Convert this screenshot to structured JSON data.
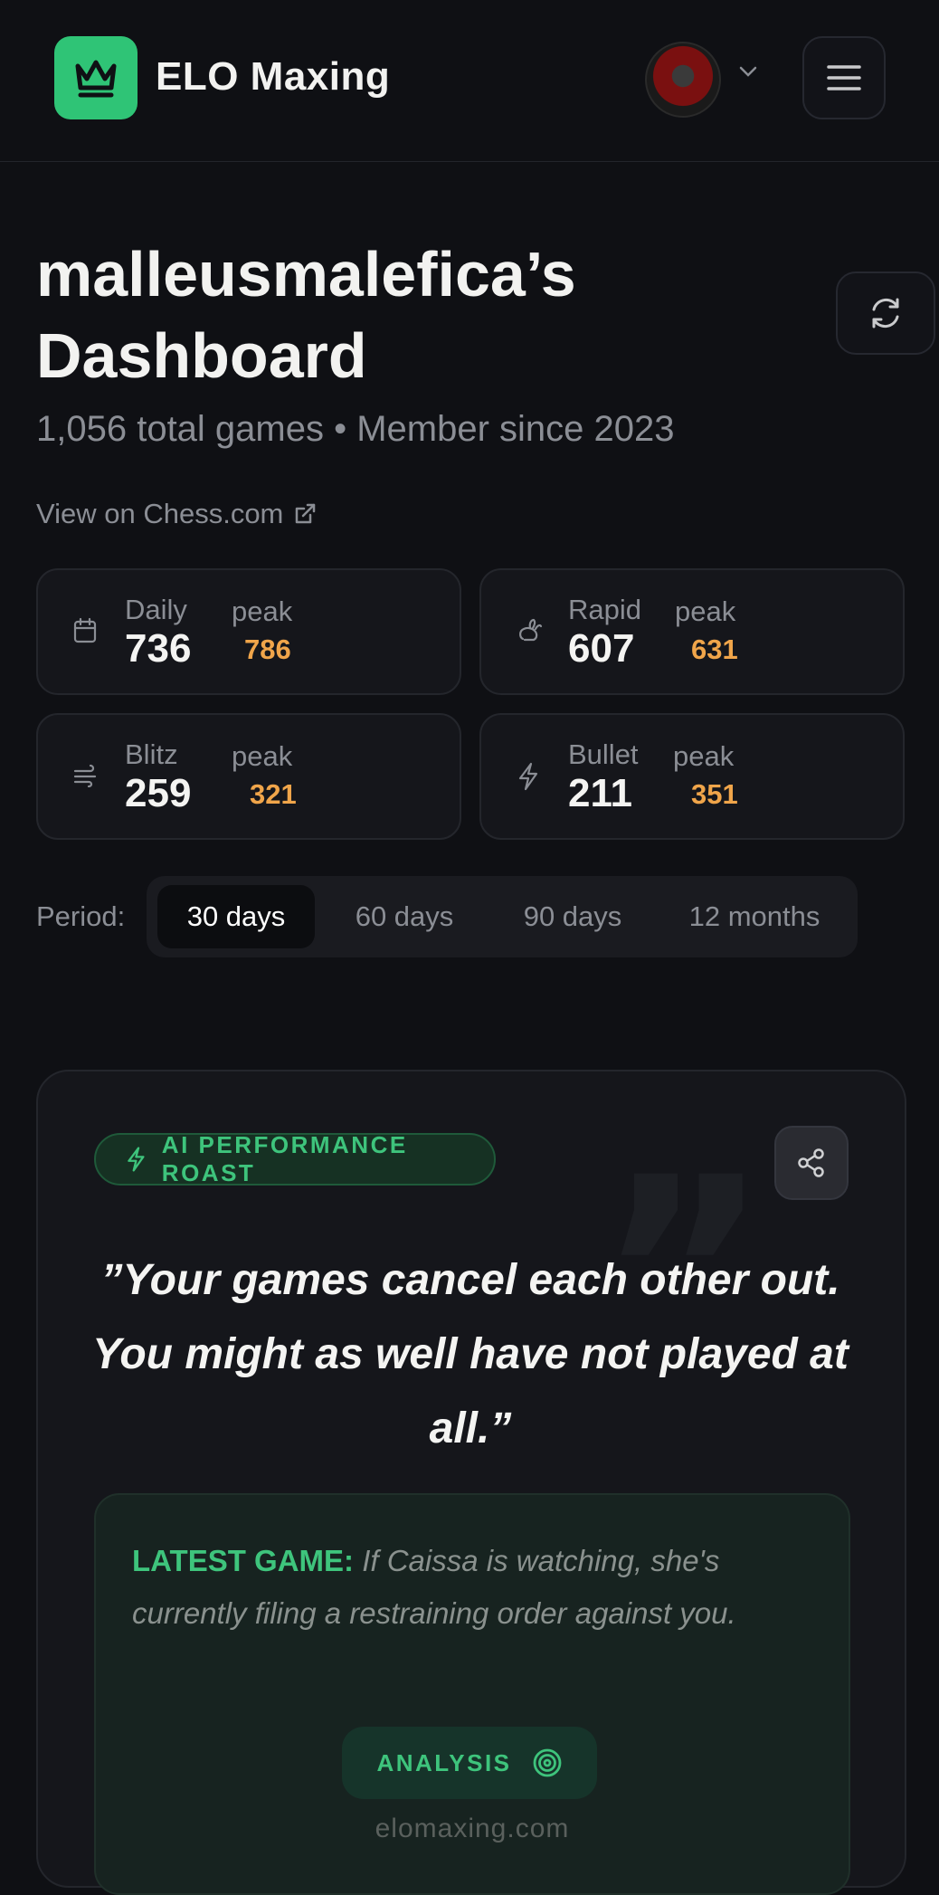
{
  "header": {
    "brand": "ELO Maxing",
    "colors": {
      "accent": "#2fc476"
    }
  },
  "dashboard": {
    "title": "malleusmalefica’s Dashboard",
    "subtitle": "1,056 total games • Member since 2023",
    "view_link": "View on Chess.com"
  },
  "ratings": [
    {
      "mode": "Daily",
      "value": "736",
      "peak_label": "peak",
      "peak": "786",
      "icon": "calendar-icon"
    },
    {
      "mode": "Rapid",
      "value": "607",
      "peak_label": "peak",
      "peak": "631",
      "icon": "rabbit-icon"
    },
    {
      "mode": "Blitz",
      "value": "259",
      "peak_label": "peak",
      "peak": "321",
      "icon": "wind-icon"
    },
    {
      "mode": "Bullet",
      "value": "211",
      "peak_label": "peak",
      "peak": "351",
      "icon": "lightning-icon"
    }
  ],
  "period": {
    "label": "Period:",
    "options": [
      "30 days",
      "60 days",
      "90 days",
      "12 months"
    ],
    "selected": "30 days"
  },
  "roast": {
    "badge": "AI PERFORMANCE ROAST",
    "quote": "”Your games cancel each other out. You might as well have not played at all.”",
    "latest_label": "LATEST GAME:",
    "latest_text": "If Caissa is watching, she's currently filing a restraining order against you.",
    "analysis_label": "ANALYSIS",
    "site": "elomaxing.com"
  }
}
